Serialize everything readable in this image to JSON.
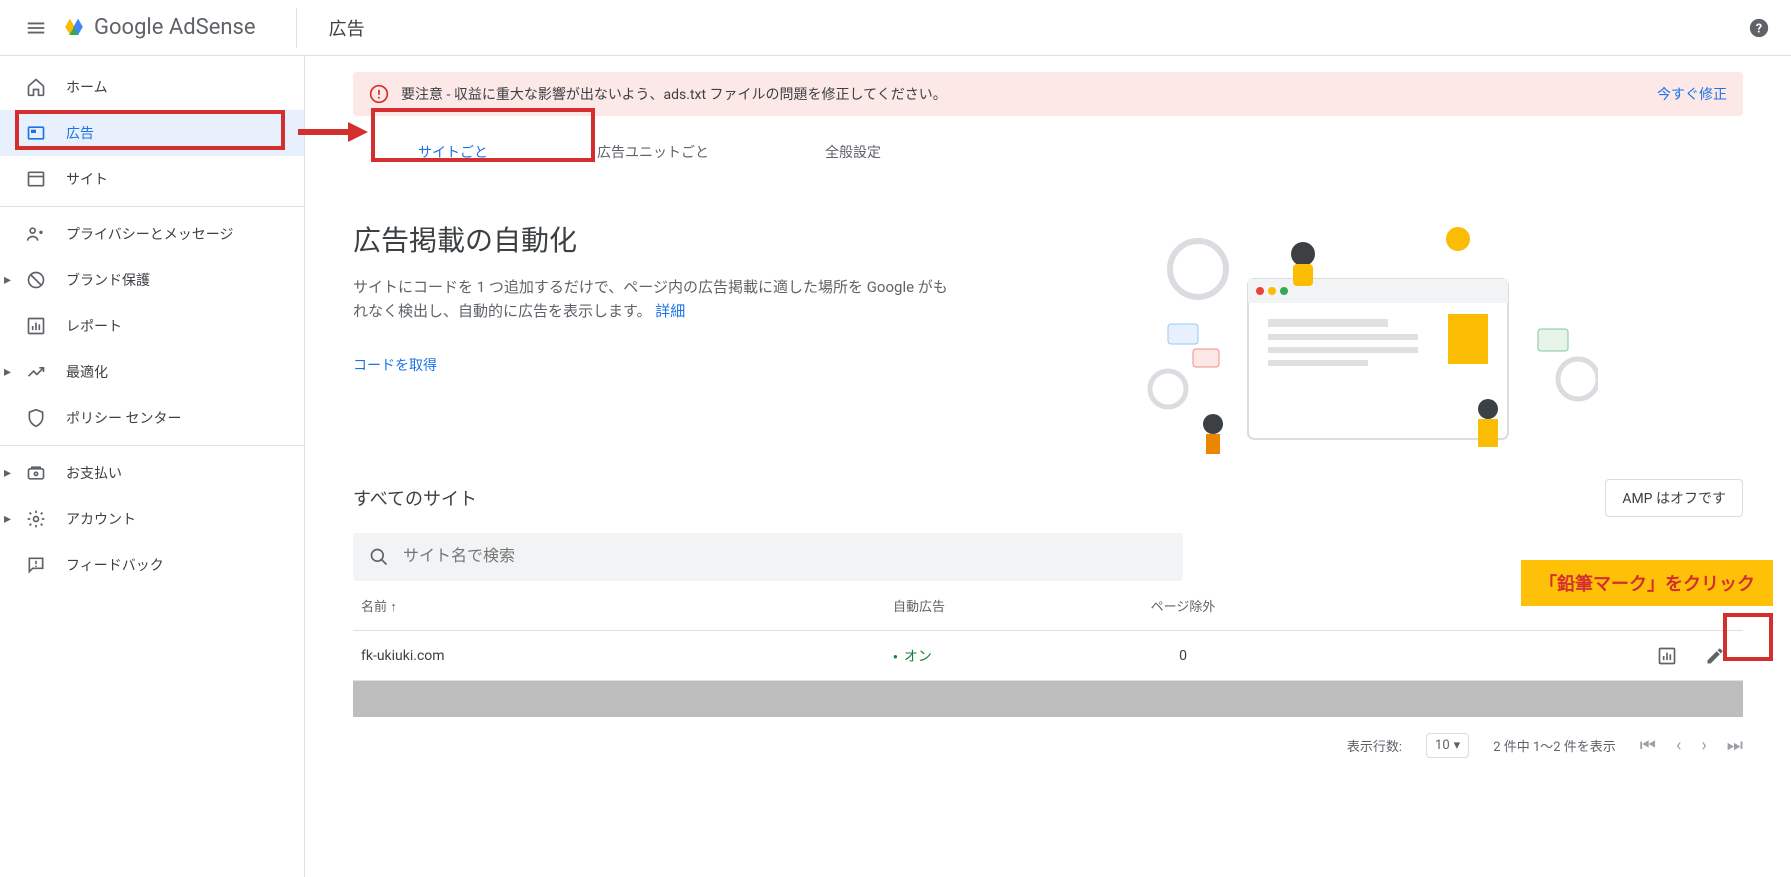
{
  "header": {
    "brand_g": "Google",
    "brand_a": " AdSense",
    "page_title": "広告"
  },
  "sidebar": {
    "items": {
      "home": "ホーム",
      "ads": "広告",
      "sites": "サイト",
      "privacy": "プライバシーとメッセージ",
      "brand": "ブランド保護",
      "reports": "レポート",
      "optimize": "最適化",
      "policy": "ポリシー センター",
      "payments": "お支払い",
      "account": "アカウント",
      "feedback": "フィードバック"
    }
  },
  "alert": {
    "text": "要注意 - 収益に重大な影響が出ないよう、ads.txt ファイルの問題を修正してください。",
    "action": "今すぐ修正"
  },
  "tabs": {
    "by_site": "サイトごと",
    "by_unit": "広告ユニットごと",
    "general": "全般設定"
  },
  "hero": {
    "title": "広告掲載の自動化",
    "desc": "サイトにコードを 1 つ追加するだけで、ページ内の広告掲載に適した場所を Google がもれなく検出し、自動的に広告を表示します。",
    "learn_more": "詳細",
    "get_code": "コードを取得"
  },
  "sites": {
    "title": "すべてのサイト",
    "amp": "AMP はオフです",
    "search_placeholder": "サイト名で検索",
    "col_name": "名前 ↑",
    "col_auto": "自動広告",
    "col_excl": "ページ除外",
    "rows": {
      "0": {
        "name": "fk-ukiuki.com",
        "status": "オン",
        "exclusions": "0"
      }
    }
  },
  "pagination": {
    "rows_label": "表示行数:",
    "rows_value": "10",
    "range": "2 件中 1～2 件を表示"
  },
  "annotation": {
    "edit_hint": "「鉛筆マーク」をクリック"
  }
}
